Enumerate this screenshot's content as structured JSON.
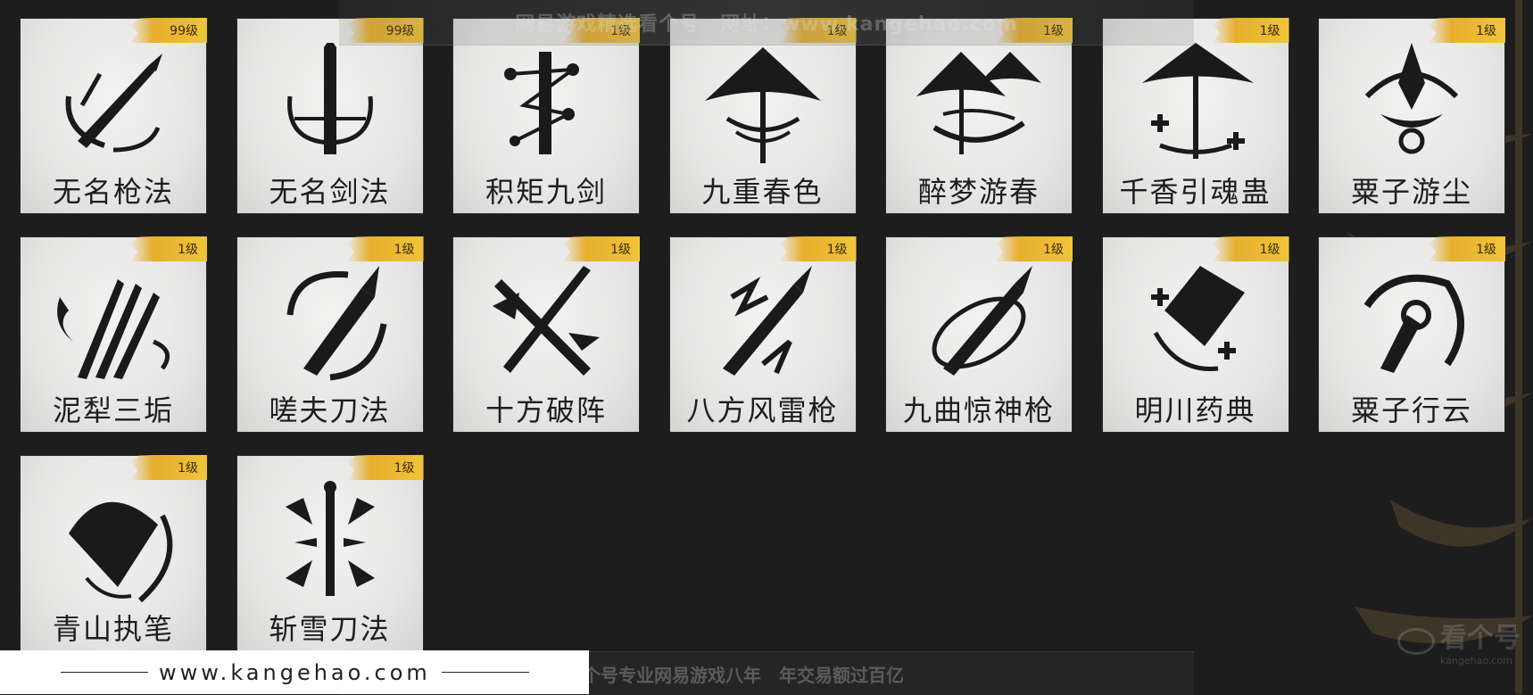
{
  "watermark": {
    "top_text": "网易游戏精选看个号　网址：www.kangehao.com",
    "bottom_slogan": "看个号专业网易游戏八年　年交易额过百亿",
    "site_url": "www.kangehao.com",
    "logo_text": "看个号",
    "logo_sub": "kangehao.com"
  },
  "skills": [
    {
      "name": "无名枪法",
      "level": "99级",
      "icon": "spear-swirl-icon"
    },
    {
      "name": "无名剑法",
      "level": "99级",
      "icon": "sword-ring-icon"
    },
    {
      "name": "积矩九剑",
      "level": "1级",
      "icon": "sword-constellation-icon"
    },
    {
      "name": "九重春色",
      "level": "1级",
      "icon": "umbrella-spiral-icon"
    },
    {
      "name": "醉梦游春",
      "level": "1级",
      "icon": "double-umbrella-icon"
    },
    {
      "name": "千香引魂蛊",
      "level": "1级",
      "icon": "umbrella-plus-icon"
    },
    {
      "name": "粟子游尘",
      "level": "1级",
      "icon": "dart-vortex-icon"
    },
    {
      "name": "泥犁三垢",
      "level": "1级",
      "icon": "triple-blade-flame-icon"
    },
    {
      "name": "嗟夫刀法",
      "level": "1级",
      "icon": "blade-circle-icon"
    },
    {
      "name": "十方破阵",
      "level": "1级",
      "icon": "crossed-swords-icon"
    },
    {
      "name": "八方风雷枪",
      "level": "1级",
      "icon": "lightning-spear-icon"
    },
    {
      "name": "九曲惊神枪",
      "level": "1级",
      "icon": "spear-orbit-icon"
    },
    {
      "name": "明川药典",
      "level": "1级",
      "icon": "fan-plus-icon"
    },
    {
      "name": "粟子行云",
      "level": "1级",
      "icon": "dart-crescent-icon"
    },
    {
      "name": "青山执笔",
      "level": "1级",
      "icon": "fan-wind-icon"
    },
    {
      "name": "斩雪刀法",
      "level": "1级",
      "icon": "sword-arrows-icon"
    }
  ],
  "colors": {
    "badge": "#f0c53a",
    "background": "#1d1d1d",
    "ink": "#1a1a1a"
  }
}
